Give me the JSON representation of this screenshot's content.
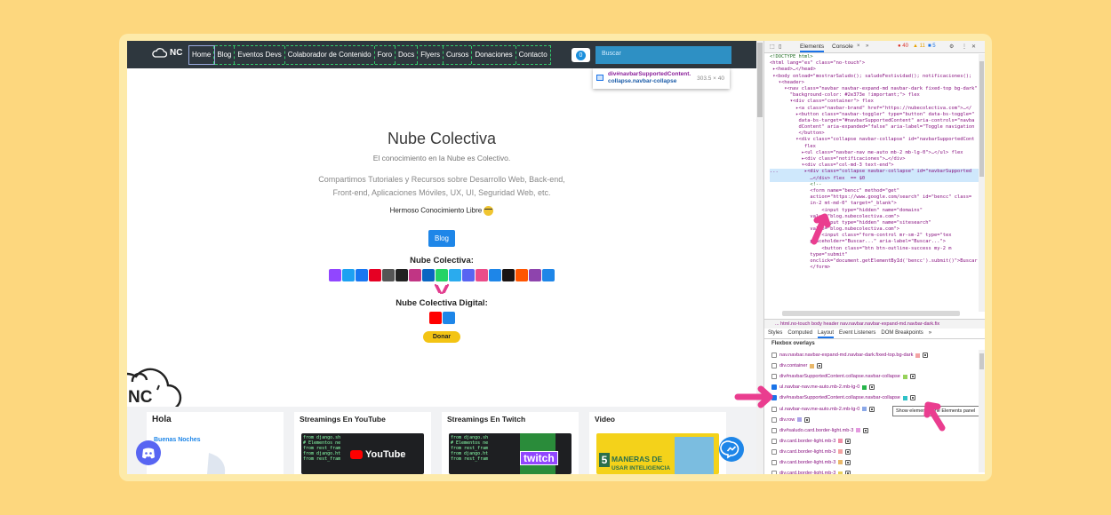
{
  "site": {
    "brand": "NC",
    "nav_items": [
      "Home",
      "Blog",
      "Eventos Devs",
      "Colaborador de Contenido",
      "Foro",
      "Docs",
      "Flyers",
      "Cursos",
      "Donaciones",
      "Contacto"
    ],
    "active_nav": "Home",
    "notification_count": "0",
    "select_placeholder": "Buscar",
    "inspect_tooltip": {
      "tag": "div#navbarSupportedContent.",
      "classes": "collapse.navbar-collapse",
      "size": "303.5 × 40"
    },
    "hero": {
      "title": "Nube Colectiva",
      "tagline": "El conocimiento en la Nube es Colectivo.",
      "description": "Compartimos Tutoriales y Recursos sobre Desarrollo Web, Back-end, Front-end, Aplicaciones Móviles, UX, UI, Seguridad Web, etc.",
      "free_knowledge": "Hermoso Conocimiento Libre",
      "blog_button": "Blog",
      "section1": "Nube Colectiva:",
      "section2": "Nube Colectiva Digital:",
      "donate_button": "Donar"
    },
    "social_icons": [
      "twitch-icon",
      "twitter-icon",
      "facebook-icon",
      "pinterest-icon",
      "instagram-tv-icon",
      "github-icon",
      "instagram-icon",
      "linkedin-icon",
      "whatsapp-icon",
      "telegram-icon",
      "discord-icon",
      "dribbble-icon",
      "podcast-icon",
      "spotify-icon",
      "soundcloud-icon",
      "podcasts-icon",
      "reddit-icon"
    ],
    "social_colors": [
      "#9146ff",
      "#1da1f2",
      "#1877f2",
      "#e60023",
      "#555555",
      "#222222",
      "#c13584",
      "#0a66c2",
      "#25d366",
      "#2aabee",
      "#5865f2",
      "#ea4c89",
      "#1e86e8",
      "#191414",
      "#ff5500",
      "#8e44ad",
      "#1e86e8"
    ],
    "digital_icons": [
      "youtube-icon",
      "discord-icon"
    ],
    "digital_colors": [
      "#ff0000",
      "#1e86e8"
    ],
    "cards": [
      {
        "title": "Hola",
        "subtitle": "Buenas Noches"
      },
      {
        "title": "Streamings En YouTube",
        "thumb_text": "YouTube",
        "code_lines": [
          "from django.sh",
          "# Elementos ne",
          "from rest_fram",
          "from django.ht",
          "from rest_fram"
        ]
      },
      {
        "title": "Streamings En Twitch",
        "thumb_text": "twitch",
        "code_lines": [
          "from django.sh",
          "# Elementos ne",
          "from rest_fram",
          "from django.ht",
          "from rest_fram"
        ]
      },
      {
        "title": "Video",
        "thumb_text": "MANERAS DE",
        "thumb_sub": "USAR INTELIGENCIA",
        "thumb_number": "5"
      }
    ]
  },
  "devtools": {
    "tabs": [
      "Elements",
      "Console"
    ],
    "active_tab": "Elements",
    "errors": "40",
    "warnings": "11",
    "info": "5",
    "code_lines": [
      {
        "t": "cm",
        "s": "<!DOCTYPE html>"
      },
      {
        "t": "tg",
        "s": "<html lang=\"es\" class=\"no-touch\">"
      },
      {
        "t": "tg",
        "s": " ▸<head>…</head>"
      },
      {
        "t": "tg",
        "s": " ▾<body onload=\"mostrarSaludo(); saludoFestividad(); notificaciones();"
      },
      {
        "t": "tg",
        "s": "   ▾<header>"
      },
      {
        "t": "tg",
        "s": "     ▾<nav class=\"navbar navbar-expand-md navbar-dark fixed-top bg-dark\""
      },
      {
        "t": "tg",
        "s": "       \"background-color: #2e373e !important;\"> flex"
      },
      {
        "t": "tg",
        "s": "       ▾<div class=\"container\"> flex"
      },
      {
        "t": "tg",
        "s": "         ▸<a class=\"navbar-brand\" href=\"https://nubecolectiva.com\">…</"
      },
      {
        "t": "tg",
        "s": "         ▸<button class=\"navbar-toggler\" type=\"button\" data-bs-toggle=\""
      },
      {
        "t": "tg",
        "s": "          data-bs-target=\"#navbarSupportedContent\" aria-controls=\"navba"
      },
      {
        "t": "tg",
        "s": "          dContent\" aria-expanded=\"false\" aria-label=\"Toggle navigation"
      },
      {
        "t": "tg",
        "s": "          </button>"
      },
      {
        "t": "tg",
        "s": "         ▾<div class=\"collapse navbar-collapse\" id=\"navbarSupportedCont"
      },
      {
        "t": "tg",
        "s": "            flex"
      },
      {
        "t": "tg",
        "s": "           ▸<ul class=\"navbar-nav me-auto mb-2 mb-lg-0\">…</ul> flex"
      },
      {
        "t": "tg",
        "s": "           ▸<div class=\"notificaciones\">…</div>"
      },
      {
        "t": "tg",
        "s": "           ▾<div class=\"col-md-3 text-end\">"
      },
      {
        "t": "hl",
        "s": "...         ▸<div class=\"collapse navbar-collapse\" id=\"navbarSupported"
      },
      {
        "t": "hl",
        "s": "              …</div> flex  == $0"
      },
      {
        "t": "cm",
        "s": "              <!--"
      },
      {
        "t": "tg",
        "s": "              <form name=\"bencc\" method=\"get\""
      },
      {
        "t": "tg",
        "s": "              action=\"https://www.google.com/search\" id=\"bencc\" class="
      },
      {
        "t": "tg",
        "s": "              in-2 mt-md-0\" target=\"_blank\">"
      },
      {
        "t": "tg",
        "s": "                  <input type=\"hidden\" name=\"domains\""
      },
      {
        "t": "tg",
        "s": "              value=\"blog.nubecolectiva.com\">"
      },
      {
        "t": "tg",
        "s": "                  <input type=\"hidden\" name=\"sitesearch\""
      },
      {
        "t": "tg",
        "s": "              value=\"blog.nubecolectiva.com\">"
      },
      {
        "t": "tg",
        "s": "                  <input class=\"form-control mr-sm-2\" type=\"tex"
      },
      {
        "t": "tg",
        "s": "              placeholder=\"Buscar...\" aria-label=\"Buscar...\">"
      },
      {
        "t": "tg",
        "s": "                  <button class=\"btn btn-outline-success my-2 m"
      },
      {
        "t": "tg",
        "s": "              type=\"submit\""
      },
      {
        "t": "tg",
        "s": "              onclick=\"document.getElementById('bencc').submit()\">Buscar"
      },
      {
        "t": "tg",
        "s": "              </form>"
      }
    ],
    "breadcrumb": "... html.no-touch   body   header   nav.navbar.navbar-expand-md.navbar-dark.fix",
    "lower_tabs": [
      "Styles",
      "Computed",
      "Layout",
      "Event Listeners",
      "DOM Breakpoints",
      "»"
    ],
    "active_lower_tab": "Layout",
    "flexbox_title": "Flexbox overlays",
    "flex_rows": [
      {
        "label": "nav.navbar.navbar-expand-md.navbar-dark.fixed-top.bg-dark",
        "color": "#f3a3a3",
        "checked": false
      },
      {
        "label": "div.container",
        "color": "#e9b86a",
        "checked": false
      },
      {
        "label": "div#navbarSupportedContent.collapse.navbar-collapse",
        "color": "#97d25b",
        "checked": false
      },
      {
        "label": "ul.navbar-nav.me-auto.mb-2.mb-lg-0",
        "color": "#25b54a",
        "checked": true
      },
      {
        "label": "div#navbarSupportedContent.collapse.navbar-collapse",
        "color": "#2fc2c7",
        "checked": true
      },
      {
        "label": "ul.navbar-nav.me-auto.mb-2.mb-lg-0",
        "color": "#8aa8e8",
        "checked": false
      },
      {
        "label": "div.row",
        "color": "#a9a3e8",
        "checked": false
      },
      {
        "label": "div#saludo.card.border-light.mb-3",
        "color": "#e49ae0",
        "checked": false
      },
      {
        "label": "div.card.border-light.mb-3",
        "color": "#f08fa8",
        "checked": false
      },
      {
        "label": "div.card.border-light.mb-3",
        "color": "#f3a3a3",
        "checked": false
      },
      {
        "label": "div.card.border-light.mb-3",
        "color": "#e9b86a",
        "checked": false
      },
      {
        "label": "div.card.border-light.mb-3",
        "color": "#e9d05a",
        "checked": false
      }
    ],
    "select_tooltip": "Show element in the Elements panel"
  },
  "colors": {
    "background": "#fdd77e",
    "nav": "#2e373e",
    "accent": "#1e86e8",
    "arrow": "#ea3d8f"
  }
}
